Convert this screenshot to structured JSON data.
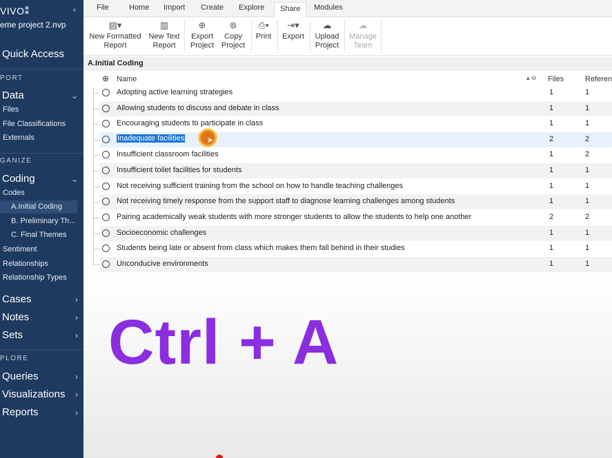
{
  "app": {
    "title": "VIVO",
    "project": "eme project 2.nvp"
  },
  "sidebar": {
    "quick_access": "Quick Access",
    "sections": {
      "import": "PORT",
      "organize": "GANIZE",
      "explore": "PLORE"
    },
    "data": {
      "label": "Data",
      "items": [
        "Files",
        "File Classifications",
        "Externals"
      ]
    },
    "coding": {
      "label": "Coding",
      "codes": "Codes",
      "subitems": [
        "A.Initial Coding",
        "B. Preliminary Th...",
        "C. Final Themes"
      ],
      "items": [
        "Sentiment",
        "Relationships",
        "Relationship Types"
      ]
    },
    "groups": [
      "Cases",
      "Notes",
      "Sets"
    ],
    "explore_groups": [
      "Queries",
      "Visualizations",
      "Reports"
    ]
  },
  "ribbon": {
    "tabs": [
      "File",
      "Home",
      "Import",
      "Create",
      "Explore",
      "Share",
      "Modules"
    ],
    "buttons": [
      {
        "l1": "New Formatted",
        "l2": "Report"
      },
      {
        "l1": "New Text",
        "l2": "Report"
      },
      {
        "l1": "Export",
        "l2": "Project"
      },
      {
        "l1": "Copy",
        "l2": "Project"
      },
      {
        "l1": "Print",
        "l2": ""
      },
      {
        "l1": "Export",
        "l2": ""
      },
      {
        "l1": "Upload",
        "l2": "Project"
      },
      {
        "l1": "Manage",
        "l2": "Team"
      }
    ]
  },
  "breadcrumb": "A.Initial Coding",
  "table": {
    "headers": {
      "name": "Name",
      "files": "Files",
      "refs": "Referen"
    },
    "rows": [
      {
        "name": "Adopting  active learning strategies",
        "files": "1",
        "refs": "1"
      },
      {
        "name": "Allowing students to discuss and debate in class",
        "files": "1",
        "refs": "1"
      },
      {
        "name": "Encouraging students to participate in class",
        "files": "1",
        "refs": "1"
      },
      {
        "name": "Inadequate facilities",
        "files": "2",
        "refs": "2"
      },
      {
        "name": "Insufficient classroom facilities",
        "files": "1",
        "refs": "2"
      },
      {
        "name": "Insufficient toilet facilities for students",
        "files": "1",
        "refs": "1"
      },
      {
        "name": "Not receiving sufficient training from the school on how to handle teaching challenges",
        "files": "1",
        "refs": "1"
      },
      {
        "name": "Not receiving timely response from the support staff to diagnose learning challenges among students",
        "files": "1",
        "refs": "1"
      },
      {
        "name": "Pairing academically weak students with more stronger students to allow the students to help one another",
        "files": "2",
        "refs": "2"
      },
      {
        "name": "Socioeconomic challenges",
        "files": "1",
        "refs": "1"
      },
      {
        "name": "Students being late or absent from class which makes them fall behind in their studies",
        "files": "1",
        "refs": "1"
      },
      {
        "name": "Unconducive environments",
        "files": "1",
        "refs": "1"
      }
    ]
  },
  "overlay_text": "Ctrl + A"
}
